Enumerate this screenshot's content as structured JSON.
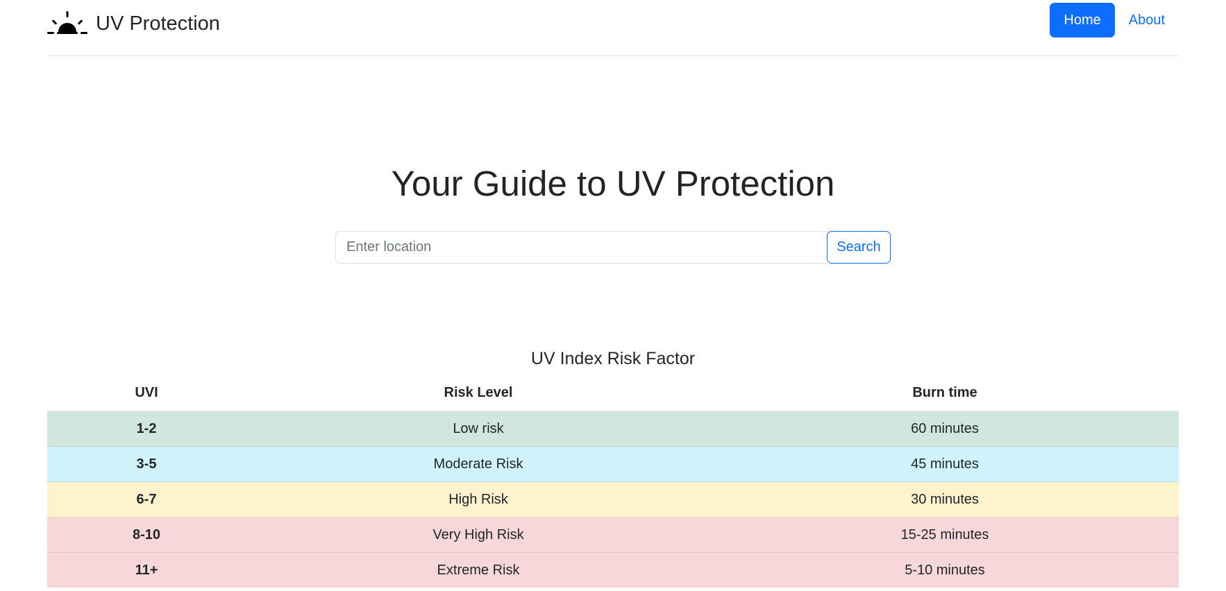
{
  "header": {
    "brand_title": "UV Protection",
    "brand_icon": "sunrise-icon",
    "nav": {
      "home_label": "Home",
      "about_label": "About"
    },
    "accent_color": "#0d6efd"
  },
  "hero": {
    "title": "Your Guide to UV Protection"
  },
  "search": {
    "placeholder": "Enter location",
    "value": "",
    "button_label": "Search"
  },
  "uv_table": {
    "caption": "UV Index Risk Factor",
    "columns": [
      "UVI",
      "Risk Level",
      "Burn time"
    ],
    "rows": [
      {
        "uvi": "1-2",
        "risk": "Low risk",
        "burn": "60 minutes",
        "color": "#d1e7dd"
      },
      {
        "uvi": "3-5",
        "risk": "Moderate Risk",
        "burn": "45 minutes",
        "color": "#cff4fc"
      },
      {
        "uvi": "6-7",
        "risk": "High Risk",
        "burn": "30 minutes",
        "color": "#fff3cd"
      },
      {
        "uvi": "8-10",
        "risk": "Very High Risk",
        "burn": "15-25 minutes",
        "color": "#f8d7da"
      },
      {
        "uvi": "11+",
        "risk": "Extreme Risk",
        "burn": "5-10 minutes",
        "color": "#f8d7da"
      }
    ]
  }
}
